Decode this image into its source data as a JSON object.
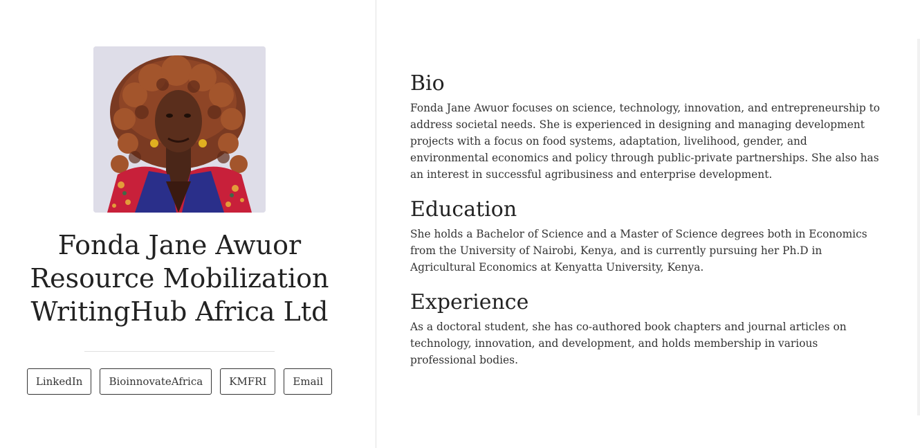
{
  "profile": {
    "name": "Fonda Jane Awuor",
    "role": "Resource Mobilization",
    "organization": "WritingHub Africa Ltd",
    "photo_icon": "profile-photo"
  },
  "links": [
    {
      "label": "LinkedIn"
    },
    {
      "label": "BioinnovateAfrica"
    },
    {
      "label": "KMFRI"
    },
    {
      "label": "Email"
    }
  ],
  "sections": {
    "bio": {
      "title": "Bio",
      "text": "Fonda Jane Awuor focuses on science, technology, innovation, and entrepreneurship to address societal needs. She is experienced in designing and managing development projects with a focus on food systems, adaptation, livelihood, gender, and environmental economics and policy through public-private partnerships. She also has an interest in successful agribusiness and enterprise development."
    },
    "education": {
      "title": "Education",
      "text": "She holds a Bachelor of Science and a Master of Science degrees both in Economics from the University of Nairobi, Kenya, and is currently pursuing her Ph.D in Agricultural Economics at Kenyatta University, Kenya."
    },
    "experience": {
      "title": "Experience",
      "text": "As a doctoral student, she has co-authored book chapters and journal articles on technology, innovation, and development, and holds membership in various professional bodies."
    }
  }
}
